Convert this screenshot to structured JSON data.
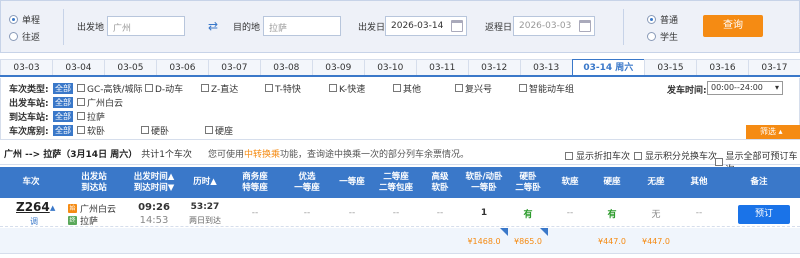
{
  "search": {
    "trip_types": [
      {
        "label": "单程",
        "selected": true
      },
      {
        "label": "往返",
        "selected": false
      }
    ],
    "from_label": "出发地",
    "from_value": "广州",
    "to_label": "目的地",
    "to_value": "拉萨",
    "depart_label": "出发日",
    "depart_value": "2026-03-14",
    "return_label": "返程日",
    "return_value": "2026-03-03",
    "passenger_types": [
      {
        "label": "普通",
        "selected": true
      },
      {
        "label": "学生",
        "selected": false
      }
    ],
    "query_label": "查询"
  },
  "date_tabs": [
    {
      "label": "03-03",
      "active": false
    },
    {
      "label": "03-04",
      "active": false
    },
    {
      "label": "03-05",
      "active": false
    },
    {
      "label": "03-06",
      "active": false
    },
    {
      "label": "03-07",
      "active": false
    },
    {
      "label": "03-08",
      "active": false
    },
    {
      "label": "03-09",
      "active": false
    },
    {
      "label": "03-10",
      "active": false
    },
    {
      "label": "03-11",
      "active": false
    },
    {
      "label": "03-12",
      "active": false
    },
    {
      "label": "03-13",
      "active": false
    },
    {
      "label": "03-14 周六",
      "active": true
    },
    {
      "label": "03-15",
      "active": false
    },
    {
      "label": "03-16",
      "active": false
    },
    {
      "label": "03-17",
      "active": false
    }
  ],
  "filters": {
    "all_label": "全部",
    "train_type_label": "车次类型:",
    "train_types": [
      "GC-高铁/城际",
      "D-动车",
      "Z-直达",
      "T-特快",
      "K-快速",
      "其他",
      "复兴号",
      "智能动车组"
    ],
    "depart_station_label": "出发车站:",
    "depart_stations": [
      "广州白云"
    ],
    "arrive_station_label": "到达车站:",
    "arrive_stations": [
      "拉萨"
    ],
    "seat_type_label": "车次席别:",
    "seat_types": [
      "软卧",
      "硬卧",
      "硬座"
    ],
    "depart_time_label": "发车时间:",
    "depart_time_value": "00:00--24:00",
    "filter_button": "筛选"
  },
  "summary": {
    "route": "广州 --> 拉萨（3月14日 周六）",
    "count": "共计1个车次",
    "tip_prefix": "您可使用",
    "tip_link": "中转换乘",
    "tip_suffix": "功能，查询途中换乘一次的部分列车余票情况。",
    "options": [
      "显示折扣车次",
      "显示积分兑换车次",
      "显示全部可预订车次"
    ]
  },
  "table": {
    "headers": [
      {
        "l1": "车次",
        "l2": ""
      },
      {
        "l1": "出发站",
        "l2": "到达站"
      },
      {
        "l1": "出发时间▲",
        "l2": "到达时间▼"
      },
      {
        "l1": "历时▲",
        "l2": ""
      },
      {
        "l1": "商务座",
        "l2": "特等座"
      },
      {
        "l1": "优选",
        "l2": "一等座"
      },
      {
        "l1": "一等座",
        "l2": ""
      },
      {
        "l1": "二等座",
        "l2": "二等包座"
      },
      {
        "l1": "高级",
        "l2": "软卧"
      },
      {
        "l1": "软卧/动卧",
        "l2": "一等卧"
      },
      {
        "l1": "硬卧",
        "l2": "二等卧"
      },
      {
        "l1": "软座",
        "l2": ""
      },
      {
        "l1": "硬座",
        "l2": ""
      },
      {
        "l1": "无座",
        "l2": ""
      },
      {
        "l1": "其他",
        "l2": ""
      },
      {
        "l1": "备注",
        "l2": ""
      }
    ],
    "row": {
      "train": "Z264",
      "train_sub": "调",
      "from_badge": "始",
      "from": "广州白云",
      "to_badge": "终",
      "to": "拉萨",
      "depart": "09:26",
      "arrive": "14:53",
      "duration": "53:27",
      "duration_note": "两日到达",
      "business": "--",
      "premium_first": "--",
      "first": "--",
      "second": "--",
      "deluxe_soft": "--",
      "soft_sleeper": "1",
      "hard_sleeper": "有",
      "soft_seat": "--",
      "hard_seat": "有",
      "standing": "无",
      "other": "--",
      "book": "预订",
      "prices": {
        "soft_sleeper": "¥1468.0",
        "hard_sleeper": "¥865.0",
        "hard_seat": "¥447.0",
        "standing": "¥447.0"
      }
    }
  }
}
